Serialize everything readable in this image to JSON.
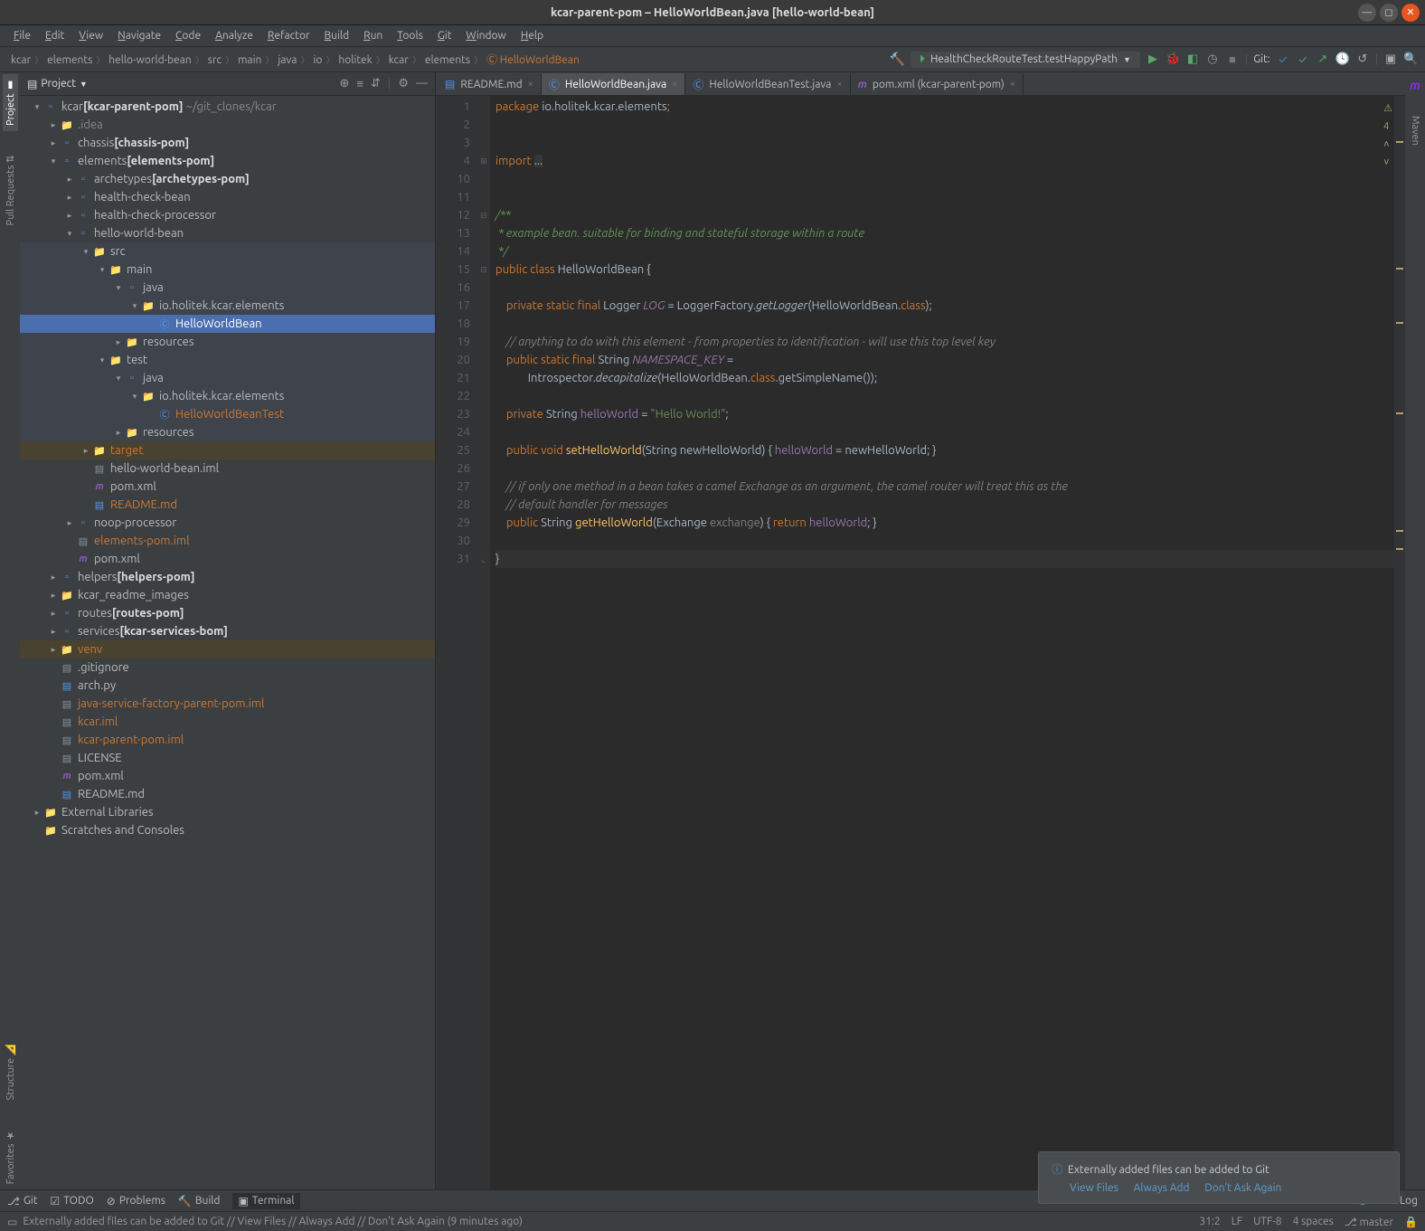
{
  "title": "kcar-parent-pom – HelloWorldBean.java [hello-world-bean]",
  "menu": [
    "File",
    "Edit",
    "View",
    "Navigate",
    "Code",
    "Analyze",
    "Refactor",
    "Build",
    "Run",
    "Tools",
    "Git",
    "Window",
    "Help"
  ],
  "breadcrumbs": [
    "kcar",
    "elements",
    "hello-world-bean",
    "src",
    "main",
    "java",
    "io",
    "holitek",
    "kcar",
    "elements",
    "HelloWorldBean"
  ],
  "runConfig": "HealthCheckRouteTest.testHappyPath",
  "toolbarGit": "Git:",
  "projectHeader": "Project",
  "tree": [
    {
      "d": 0,
      "e": "v",
      "i": "mod",
      "t": "kcar",
      "b": "[kcar-parent-pom]",
      "g": "~/git_clones/kcar"
    },
    {
      "d": 1,
      "e": ">",
      "i": "fldr",
      "t": ".idea",
      "cls": "lbll"
    },
    {
      "d": 1,
      "e": ">",
      "i": "mod",
      "t": "chassis",
      "b": "[chassis-pom]"
    },
    {
      "d": 1,
      "e": "v",
      "i": "mod",
      "t": "elements",
      "b": "[elements-pom]"
    },
    {
      "d": 2,
      "e": ">",
      "i": "mod",
      "t": "archetypes",
      "b": "[archetypes-pom]"
    },
    {
      "d": 2,
      "e": ">",
      "i": "mod",
      "t": "health-check-bean"
    },
    {
      "d": 2,
      "e": ">",
      "i": "mod",
      "t": "health-check-processor"
    },
    {
      "d": 2,
      "e": "v",
      "i": "mod",
      "t": "hello-world-bean"
    },
    {
      "d": 3,
      "e": "v",
      "i": "fldr",
      "t": "src",
      "row": "hlg"
    },
    {
      "d": 4,
      "e": "v",
      "i": "fldr",
      "t": "main",
      "row": "hlg"
    },
    {
      "d": 5,
      "e": "v",
      "i": "mod",
      "t": "java",
      "row": "hlg"
    },
    {
      "d": 6,
      "e": "v",
      "i": "pkg",
      "t": "io.holitek.kcar.elements",
      "row": "hlg"
    },
    {
      "d": 7,
      "e": " ",
      "i": "cls",
      "t": "HelloWorldBean",
      "row": "sel"
    },
    {
      "d": 5,
      "e": ">",
      "i": "fldr",
      "t": "resources",
      "row": "hlg"
    },
    {
      "d": 4,
      "e": "v",
      "i": "fldr",
      "t": "test",
      "row": "hlg"
    },
    {
      "d": 5,
      "e": "v",
      "i": "mod",
      "t": "java",
      "row": "hlg"
    },
    {
      "d": 6,
      "e": "v",
      "i": "pkg",
      "t": "io.holitek.kcar.elements",
      "row": "hlg"
    },
    {
      "d": 7,
      "e": " ",
      "i": "cls",
      "t": "HelloWorldBeanTest",
      "cls": "lblo",
      "row": "hlg"
    },
    {
      "d": 5,
      "e": ">",
      "i": "fldr",
      "t": "resources",
      "row": "hlg"
    },
    {
      "d": 3,
      "e": ">",
      "i": "fldr",
      "t": "target",
      "cls": "lblo",
      "row": "hlo"
    },
    {
      "d": 3,
      "e": " ",
      "i": "fil",
      "t": "hello-world-bean.iml"
    },
    {
      "d": 3,
      "e": " ",
      "i": "mvn",
      "t": "pom.xml"
    },
    {
      "d": 3,
      "e": " ",
      "i": "md",
      "t": "README.md",
      "cls": "lblo"
    },
    {
      "d": 2,
      "e": ">",
      "i": "mod",
      "t": "noop-processor"
    },
    {
      "d": 2,
      "e": " ",
      "i": "fil",
      "t": "elements-pom.iml",
      "cls": "lblo"
    },
    {
      "d": 2,
      "e": " ",
      "i": "mvn",
      "t": "pom.xml"
    },
    {
      "d": 1,
      "e": ">",
      "i": "mod",
      "t": "helpers",
      "b": "[helpers-pom]"
    },
    {
      "d": 1,
      "e": ">",
      "i": "fldr",
      "t": "kcar_readme_images"
    },
    {
      "d": 1,
      "e": ">",
      "i": "mod",
      "t": "routes",
      "b": "[routes-pom]"
    },
    {
      "d": 1,
      "e": ">",
      "i": "mod",
      "t": "services",
      "b": "[kcar-services-bom]"
    },
    {
      "d": 1,
      "e": ">",
      "i": "fldr",
      "t": "venv",
      "cls": "lblo",
      "row": "hlo"
    },
    {
      "d": 1,
      "e": " ",
      "i": "fil",
      "t": ".gitignore"
    },
    {
      "d": 1,
      "e": " ",
      "i": "py",
      "t": "arch.py"
    },
    {
      "d": 1,
      "e": " ",
      "i": "fil",
      "t": "java-service-factory-parent-pom.iml",
      "cls": "lblo"
    },
    {
      "d": 1,
      "e": " ",
      "i": "fil",
      "t": "kcar.iml",
      "cls": "lblo"
    },
    {
      "d": 1,
      "e": " ",
      "i": "fil",
      "t": "kcar-parent-pom.iml",
      "cls": "lblo"
    },
    {
      "d": 1,
      "e": " ",
      "i": "fil",
      "t": "LICENSE"
    },
    {
      "d": 1,
      "e": " ",
      "i": "mvn",
      "t": "pom.xml"
    },
    {
      "d": 1,
      "e": " ",
      "i": "md",
      "t": "README.md"
    },
    {
      "d": 0,
      "e": ">",
      "i": "fldr",
      "t": "External Libraries"
    },
    {
      "d": 0,
      "e": " ",
      "i": "fldr",
      "t": "Scratches and Consoles"
    }
  ],
  "editorTabs": [
    {
      "label": "README.md",
      "icon": "md"
    },
    {
      "label": "HelloWorldBean.java",
      "icon": "cls",
      "active": true
    },
    {
      "label": "HelloWorldBeanTest.java",
      "icon": "cls"
    },
    {
      "label": "pom.xml (kcar-parent-pom)",
      "icon": "mvn"
    }
  ],
  "warnings": "4",
  "code": {
    "package": "package io.holitek.kcar.elements;",
    "import": "import ...",
    "doc1": "/**",
    "doc2": " * example bean. suitable for binding and stateful storage within a route",
    "doc3": " */",
    "lines": [
      1,
      2,
      3,
      4,
      10,
      11,
      12,
      13,
      14,
      15,
      16,
      17,
      18,
      19,
      20,
      21,
      22,
      23,
      24,
      25,
      26,
      27,
      28,
      29,
      30,
      31
    ]
  },
  "notif": {
    "title": "Externally added files can be added to Git",
    "links": [
      "View Files",
      "Always Add",
      "Don't Ask Again"
    ]
  },
  "bottomTabs": [
    "Git",
    "TODO",
    "Problems",
    "Build",
    "Terminal"
  ],
  "eventLog": "Event Log",
  "status": {
    "msg": "Externally added files can be added to Git // View Files // Always Add // Don't Ask Again (9 minutes ago)",
    "pos": "31:2",
    "lf": "LF",
    "enc": "UTF-8",
    "indent": "4 spaces",
    "branch": "master"
  }
}
